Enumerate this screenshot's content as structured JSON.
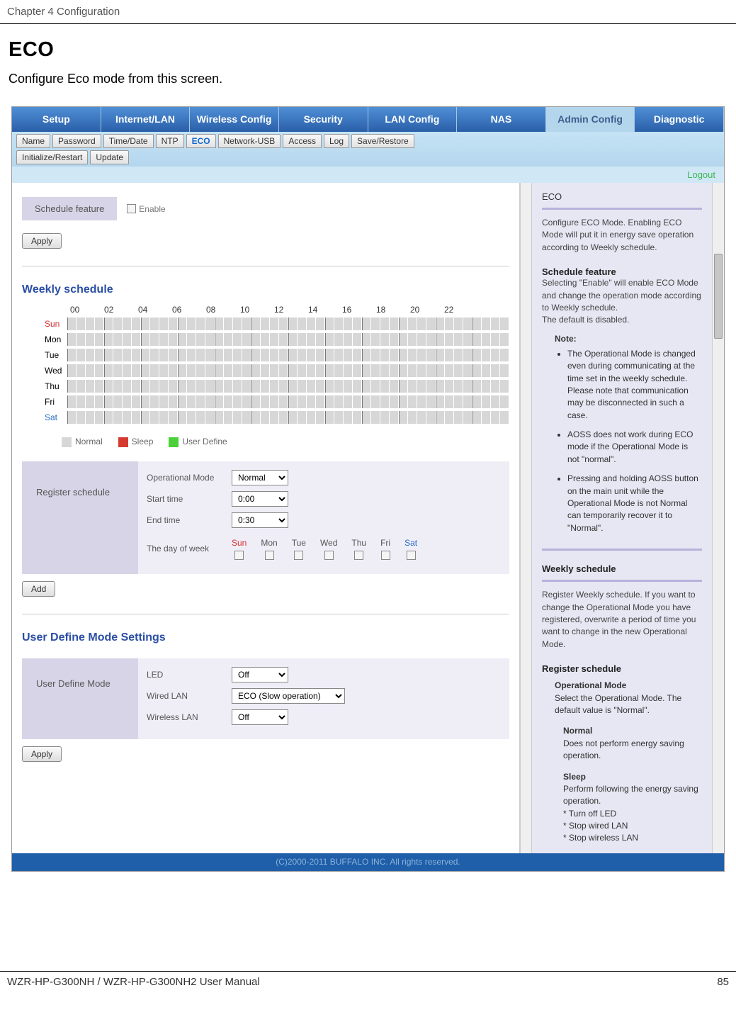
{
  "chapter": "Chapter 4  Configuration",
  "title": "ECO",
  "description": "Configure Eco mode from this screen.",
  "main_tabs": [
    "Setup",
    "Internet/LAN",
    "Wireless Config",
    "Security",
    "LAN Config",
    "NAS",
    "Admin Config",
    "Diagnostic"
  ],
  "sub_tabs_row1": [
    "Name",
    "Password",
    "Time/Date",
    "NTP",
    "ECO",
    "Network-USB",
    "Access",
    "Log",
    "Save/Restore"
  ],
  "sub_tabs_row2": [
    "Initialize/Restart",
    "Update"
  ],
  "logout": "Logout",
  "schedule_feature_label": "Schedule feature",
  "enable_label": "Enable",
  "apply_btn": "Apply",
  "weekly_title": "Weekly schedule",
  "hours": [
    "00",
    "02",
    "04",
    "06",
    "08",
    "10",
    "12",
    "14",
    "16",
    "18",
    "20",
    "22"
  ],
  "days": [
    "Sun",
    "Mon",
    "Tue",
    "Wed",
    "Thu",
    "Fri",
    "Sat"
  ],
  "legend": {
    "normal": "Normal",
    "sleep": "Sleep",
    "user": "User Define"
  },
  "register_schedule": {
    "panel_label": "Register schedule",
    "op_mode_lbl": "Operational Mode",
    "op_mode_val": "Normal",
    "start_lbl": "Start time",
    "start_val": "0:00",
    "end_lbl": "End time",
    "end_val": "0:30",
    "dow_lbl": "The day of week",
    "dows": [
      "Sun",
      "Mon",
      "Tue",
      "Wed",
      "Thu",
      "Fri",
      "Sat"
    ]
  },
  "add_btn": "Add",
  "user_define_title": "User Define Mode Settings",
  "user_define": {
    "panel_label": "User Define Mode",
    "led_lbl": "LED",
    "led_val": "Off",
    "wired_lbl": "Wired LAN",
    "wired_val": "ECO (Slow operation)",
    "wireless_lbl": "Wireless LAN",
    "wireless_val": "Off"
  },
  "help": {
    "title": "ECO",
    "intro": "Configure ECO Mode. Enabling ECO Mode will put it in energy save operation according to Weekly schedule.",
    "sf_title": "Schedule feature",
    "sf_text": "Selecting \"Enable\" will enable ECO Mode and change the operation mode according to Weekly schedule.\nThe default is disabled.",
    "note_label": "Note:",
    "notes": [
      "The Operational Mode is changed even during communicating at the time set in the weekly schedule. Please note that communication may be disconnected in such a case.",
      "AOSS does not work during ECO mode if the Operational Mode is not \"normal\".",
      "Pressing and holding AOSS button on the main unit while the Operational Mode is not Normal can temporarily recover it to \"Normal\"."
    ],
    "ws_title": "Weekly schedule",
    "ws_text": "Register Weekly schedule. If you want to change the Operational Mode you have registered, overwrite a period of time you want to change in the new Operational Mode.",
    "rs_title": "Register schedule",
    "rs_op_title": "Operational Mode",
    "rs_op_text": "Select the Operational Mode. The default value is \"Normal\".",
    "normal_title": "Normal",
    "normal_text": "Does not perform energy saving operation.",
    "sleep_title": "Sleep",
    "sleep_text": "Perform following the energy saving operation.\n* Turn off LED\n* Stop wired LAN\n* Stop wireless LAN"
  },
  "copyright": "(C)2000-2011 BUFFALO INC. All rights reserved.",
  "footer_left": "WZR-HP-G300NH / WZR-HP-G300NH2 User Manual",
  "footer_right": "85"
}
